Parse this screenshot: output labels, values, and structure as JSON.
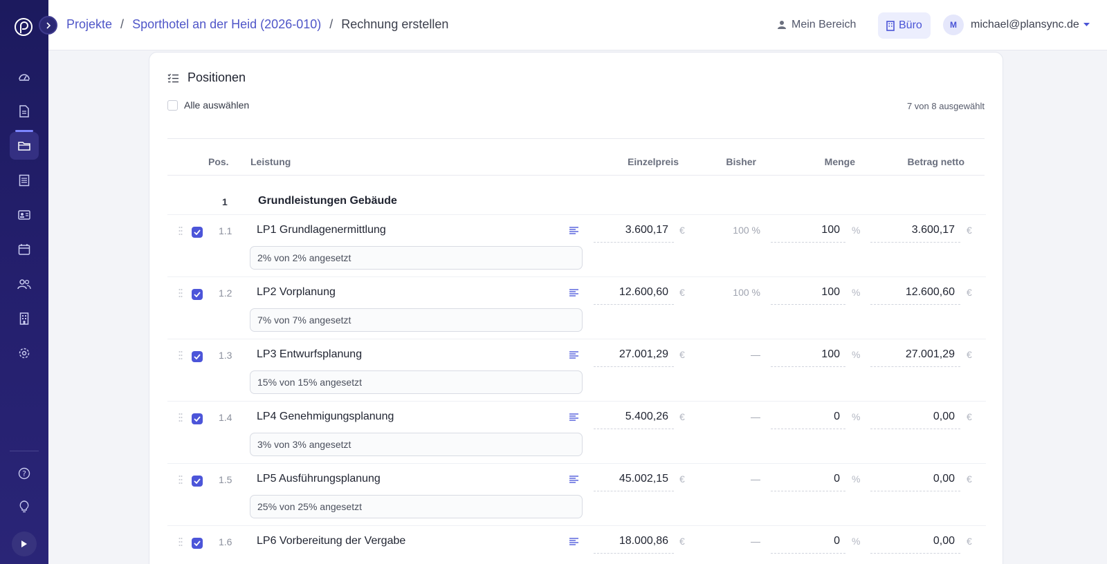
{
  "breadcrumb": {
    "projects": "Projekte",
    "project": "Sporthotel an der Heid (2026-010)",
    "current": "Rechnung erstellen",
    "separator": "/"
  },
  "header": {
    "mein_bereich": "Mein Bereich",
    "buero": "Büro",
    "avatar_initial": "M",
    "email": "michael@plansync.de"
  },
  "sidebar": {
    "items": [
      "dashboard-icon",
      "document-icon",
      "folder-icon",
      "list-icon",
      "contact-card-icon",
      "calendar-icon",
      "people-icon",
      "building-icon",
      "gear-icon"
    ],
    "bottom": [
      "help-icon",
      "lightbulb-icon",
      "play-icon"
    ],
    "accent": "#7c86ff"
  },
  "card": {
    "title": "Positionen",
    "select_all": "Alle auswählen",
    "selected_count": "7 von 8 ausgewählt"
  },
  "table": {
    "headers": {
      "pos": "Pos.",
      "leistung": "Leistung",
      "einzelpreis": "Einzelpreis",
      "bisher": "Bisher",
      "menge": "Menge",
      "betrag": "Betrag netto"
    },
    "group": {
      "num": "1",
      "title": "Grundleistungen Gebäude"
    },
    "currency": "€",
    "percent": "%",
    "rows": [
      {
        "pos": "1.1",
        "name": "LP1 Grundlagenermittlung",
        "note": "2% von 2% angesetzt",
        "price": "3.600,17",
        "bisher": "100 %",
        "menge": "100",
        "betrag": "3.600,17",
        "checked": true
      },
      {
        "pos": "1.2",
        "name": "LP2 Vorplanung",
        "note": "7% von 7% angesetzt",
        "price": "12.600,60",
        "bisher": "100 %",
        "menge": "100",
        "betrag": "12.600,60",
        "checked": true
      },
      {
        "pos": "1.3",
        "name": "LP3 Entwurfsplanung",
        "note": "15% von 15% angesetzt",
        "price": "27.001,29",
        "bisher": "—",
        "menge": "100",
        "betrag": "27.001,29",
        "checked": true
      },
      {
        "pos": "1.4",
        "name": "LP4 Genehmigungsplanung",
        "note": "3% von 3% angesetzt",
        "price": "5.400,26",
        "bisher": "—",
        "menge": "0",
        "betrag": "0,00",
        "checked": true
      },
      {
        "pos": "1.5",
        "name": "LP5 Ausführungsplanung",
        "note": "25% von 25% angesetzt",
        "price": "45.002,15",
        "bisher": "—",
        "menge": "0",
        "betrag": "0,00",
        "checked": true
      },
      {
        "pos": "1.6",
        "name": "LP6 Vorbereitung der Vergabe",
        "note": "",
        "price": "18.000,86",
        "bisher": "—",
        "menge": "0",
        "betrag": "0,00",
        "checked": true
      }
    ]
  }
}
